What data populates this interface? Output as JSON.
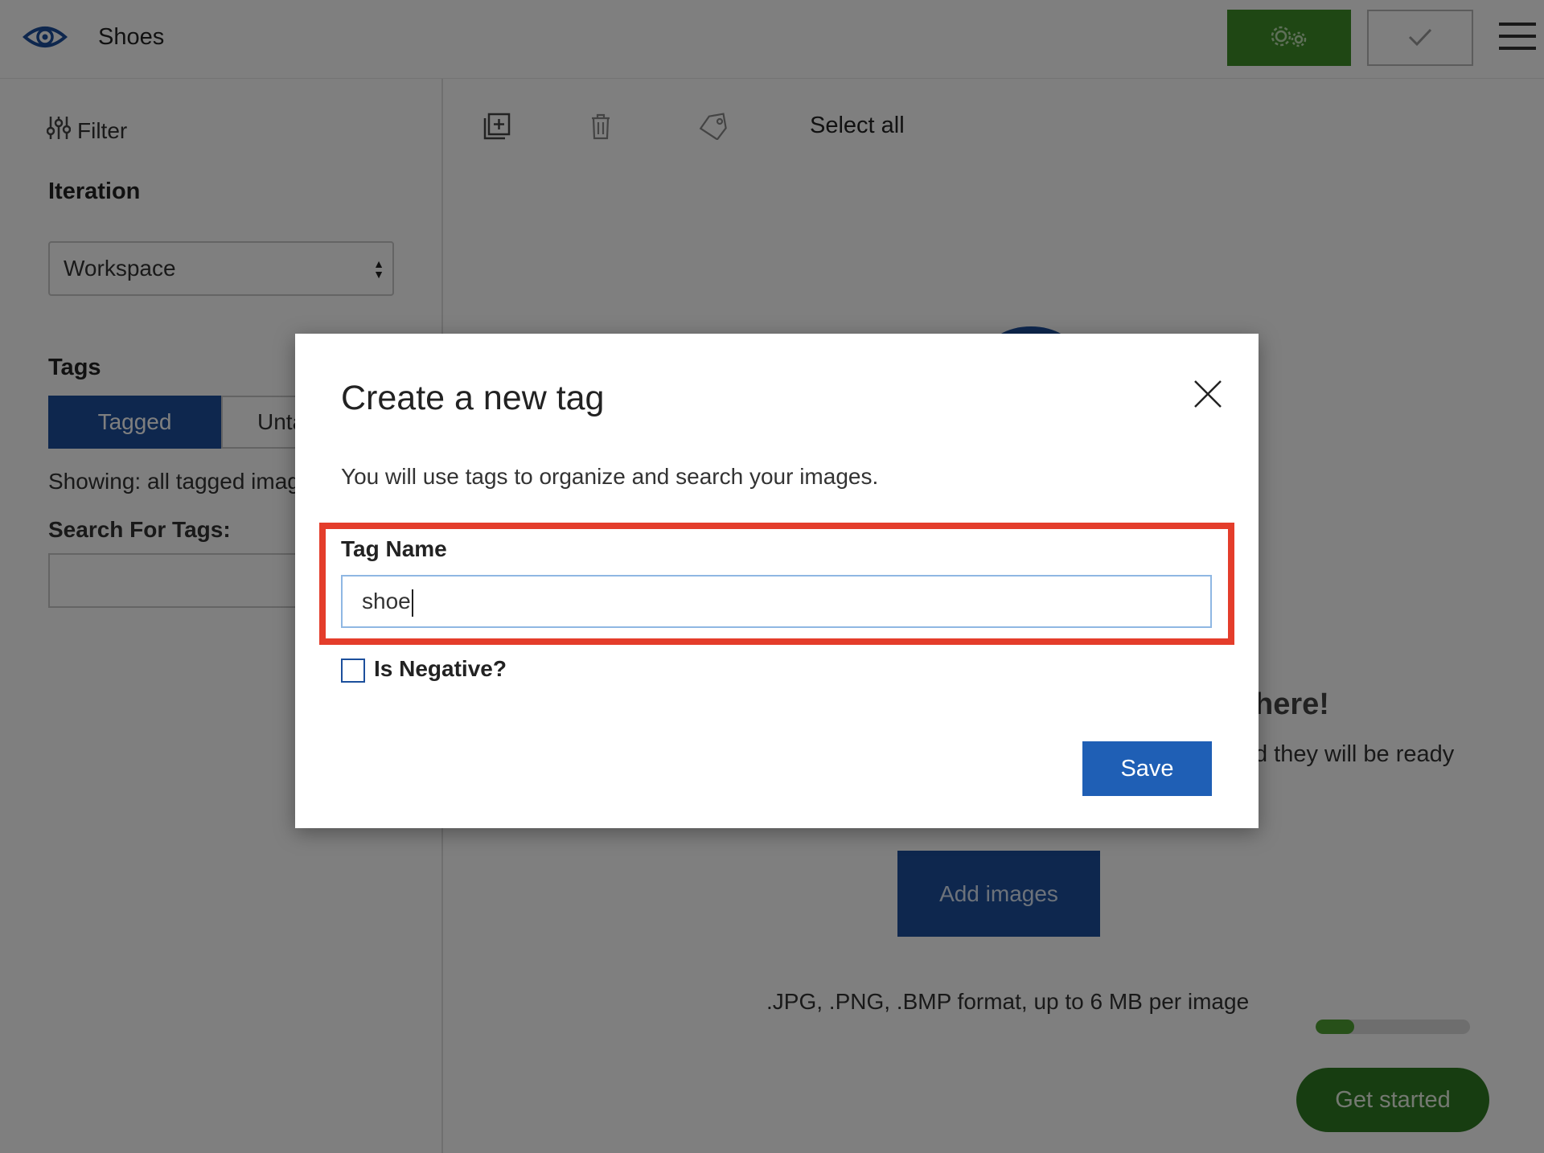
{
  "header": {
    "title": "Shoes",
    "logo_icon": "eye-icon",
    "settings_icon": "gears-icon",
    "train_icon": "check-icon",
    "menu_icon": "hamburger-icon",
    "settings_color": "#3e8e29"
  },
  "sidebar": {
    "filter_label": "Filter",
    "iteration_label": "Iteration",
    "iteration_value": "Workspace",
    "tags_label": "Tags",
    "tabs": [
      {
        "label": "Tagged",
        "active": true
      },
      {
        "label": "Untagged",
        "active": false
      }
    ],
    "showing_text": "Showing: all tagged images",
    "search_label": "Search For Tags:",
    "search_value": ""
  },
  "toolbar": {
    "add_icon": "add-images-icon",
    "delete_icon": "trash-icon",
    "tag_icon": "tag-icon",
    "select_all": "Select all"
  },
  "empty_state": {
    "heading": "here!",
    "description": "d they will be ready",
    "add_images_label": "Add images",
    "format_note": ".JPG, .PNG, .BMP format, up to 6 MB per image"
  },
  "onboarding": {
    "progress": 0.25,
    "get_started_label": "Get started",
    "accent": "#2f7a22"
  },
  "modal": {
    "title": "Create a new tag",
    "description": "You will use tags to organize and search your images.",
    "tag_name_label": "Tag Name",
    "tag_name_value": "shoe",
    "is_negative_label": "Is Negative?",
    "is_negative_checked": false,
    "save_label": "Save",
    "close_icon": "close-icon",
    "highlight_color": "#e43d2b",
    "primary_color": "#1f5fb5"
  }
}
